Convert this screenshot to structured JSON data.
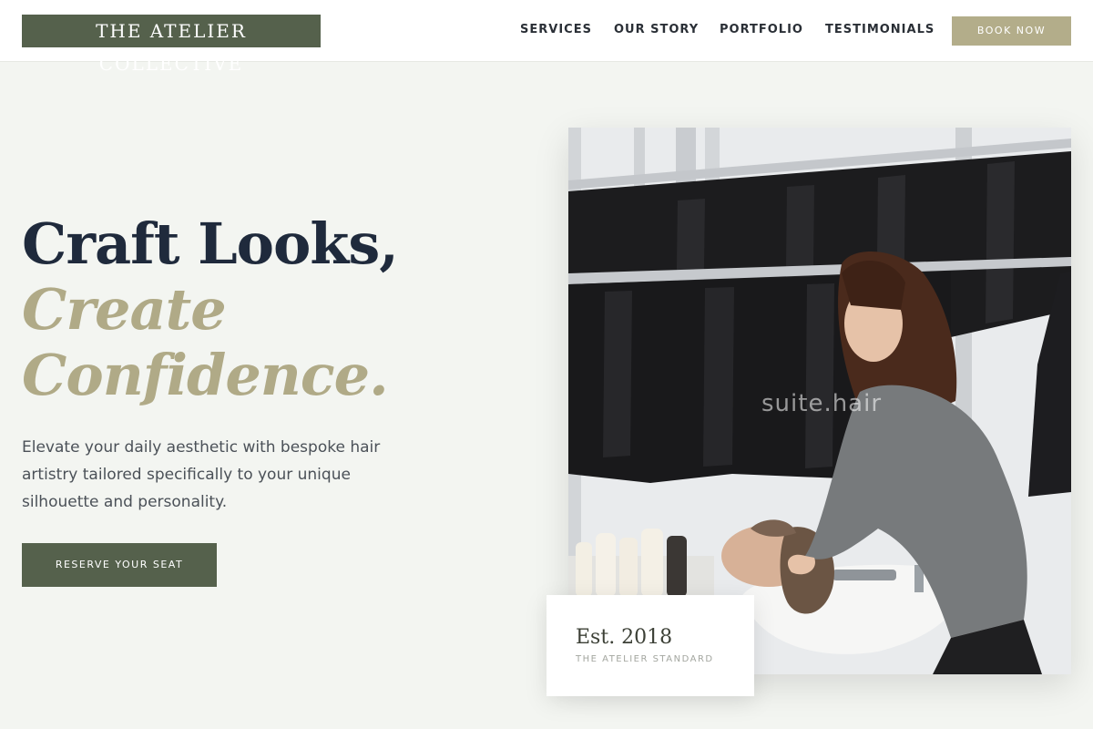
{
  "brand": {
    "name": "THE ATELIER COLLECTIVE"
  },
  "nav": {
    "items": [
      "SERVICES",
      "OUR STORY",
      "PORTFOLIO",
      "TESTIMONIALS"
    ],
    "cta": "BOOK NOW"
  },
  "hero": {
    "headline_line1": "Craft Looks,",
    "headline_line2": "Create",
    "headline_line3": "Confidence.",
    "description": "Elevate your daily aesthetic with bespoke hair artistry tailored specifically to your unique silhouette and personality.",
    "cta": "RESERVE YOUR SEAT"
  },
  "photo": {
    "watermark": "suite.hair"
  },
  "badge": {
    "title": "Est. 2018",
    "subtitle": "THE ATELIER STANDARD"
  },
  "colors": {
    "primary": "#55614c",
    "accent": "#b0aa87",
    "cta_secondary": "#b3ad8a",
    "background": "#f3f5f1",
    "heading": "#1f2a3c"
  }
}
